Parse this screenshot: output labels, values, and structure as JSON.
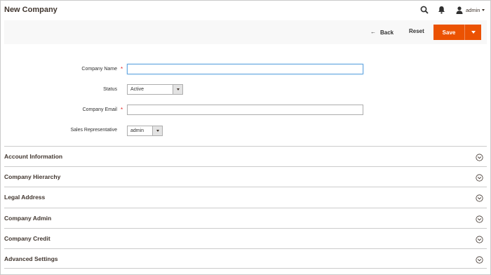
{
  "header": {
    "title": "New Company",
    "user_name": "admin",
    "icons": {
      "search": "search-icon",
      "notifications": "bell-icon",
      "user": "user-icon"
    }
  },
  "actions": {
    "back_label": "Back",
    "back_arrow": "←",
    "reset_label": "Reset",
    "save_label": "Save"
  },
  "form": {
    "company_name": {
      "label": "Company Name",
      "required_mark": "*",
      "value": ""
    },
    "status": {
      "label": "Status",
      "value": "Active"
    },
    "company_email": {
      "label": "Company Email",
      "required_mark": "*",
      "value": ""
    },
    "sales_rep": {
      "label": "Sales Representative",
      "value": "admin"
    }
  },
  "sections": [
    {
      "title": "Account Information"
    },
    {
      "title": "Company Hierarchy"
    },
    {
      "title": "Legal Address"
    },
    {
      "title": "Company Admin"
    },
    {
      "title": "Company Credit"
    },
    {
      "title": "Advanced Settings"
    }
  ],
  "colors": {
    "primary_button": "#eb5202",
    "required": "#e22626",
    "focus_border": "#68a8e0"
  }
}
